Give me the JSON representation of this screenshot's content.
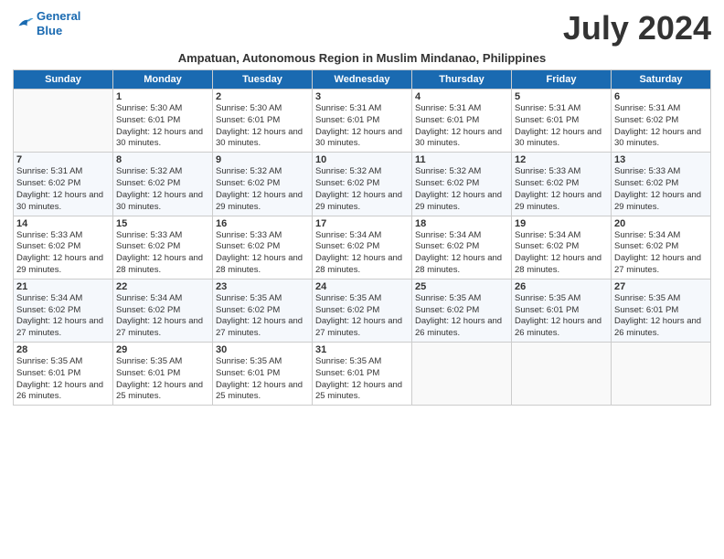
{
  "header": {
    "logo_line1": "General",
    "logo_line2": "Blue",
    "month_year": "July 2024",
    "subtitle": "Ampatuan, Autonomous Region in Muslim Mindanao, Philippines"
  },
  "days_of_week": [
    "Sunday",
    "Monday",
    "Tuesday",
    "Wednesday",
    "Thursday",
    "Friday",
    "Saturday"
  ],
  "weeks": [
    [
      {
        "day": "",
        "sunrise": "",
        "sunset": "",
        "daylight": ""
      },
      {
        "day": "1",
        "sunrise": "Sunrise: 5:30 AM",
        "sunset": "Sunset: 6:01 PM",
        "daylight": "Daylight: 12 hours and 30 minutes."
      },
      {
        "day": "2",
        "sunrise": "Sunrise: 5:30 AM",
        "sunset": "Sunset: 6:01 PM",
        "daylight": "Daylight: 12 hours and 30 minutes."
      },
      {
        "day": "3",
        "sunrise": "Sunrise: 5:31 AM",
        "sunset": "Sunset: 6:01 PM",
        "daylight": "Daylight: 12 hours and 30 minutes."
      },
      {
        "day": "4",
        "sunrise": "Sunrise: 5:31 AM",
        "sunset": "Sunset: 6:01 PM",
        "daylight": "Daylight: 12 hours and 30 minutes."
      },
      {
        "day": "5",
        "sunrise": "Sunrise: 5:31 AM",
        "sunset": "Sunset: 6:01 PM",
        "daylight": "Daylight: 12 hours and 30 minutes."
      },
      {
        "day": "6",
        "sunrise": "Sunrise: 5:31 AM",
        "sunset": "Sunset: 6:02 PM",
        "daylight": "Daylight: 12 hours and 30 minutes."
      }
    ],
    [
      {
        "day": "7",
        "sunrise": "Sunrise: 5:31 AM",
        "sunset": "Sunset: 6:02 PM",
        "daylight": "Daylight: 12 hours and 30 minutes."
      },
      {
        "day": "8",
        "sunrise": "Sunrise: 5:32 AM",
        "sunset": "Sunset: 6:02 PM",
        "daylight": "Daylight: 12 hours and 30 minutes."
      },
      {
        "day": "9",
        "sunrise": "Sunrise: 5:32 AM",
        "sunset": "Sunset: 6:02 PM",
        "daylight": "Daylight: 12 hours and 29 minutes."
      },
      {
        "day": "10",
        "sunrise": "Sunrise: 5:32 AM",
        "sunset": "Sunset: 6:02 PM",
        "daylight": "Daylight: 12 hours and 29 minutes."
      },
      {
        "day": "11",
        "sunrise": "Sunrise: 5:32 AM",
        "sunset": "Sunset: 6:02 PM",
        "daylight": "Daylight: 12 hours and 29 minutes."
      },
      {
        "day": "12",
        "sunrise": "Sunrise: 5:33 AM",
        "sunset": "Sunset: 6:02 PM",
        "daylight": "Daylight: 12 hours and 29 minutes."
      },
      {
        "day": "13",
        "sunrise": "Sunrise: 5:33 AM",
        "sunset": "Sunset: 6:02 PM",
        "daylight": "Daylight: 12 hours and 29 minutes."
      }
    ],
    [
      {
        "day": "14",
        "sunrise": "Sunrise: 5:33 AM",
        "sunset": "Sunset: 6:02 PM",
        "daylight": "Daylight: 12 hours and 29 minutes."
      },
      {
        "day": "15",
        "sunrise": "Sunrise: 5:33 AM",
        "sunset": "Sunset: 6:02 PM",
        "daylight": "Daylight: 12 hours and 28 minutes."
      },
      {
        "day": "16",
        "sunrise": "Sunrise: 5:33 AM",
        "sunset": "Sunset: 6:02 PM",
        "daylight": "Daylight: 12 hours and 28 minutes."
      },
      {
        "day": "17",
        "sunrise": "Sunrise: 5:34 AM",
        "sunset": "Sunset: 6:02 PM",
        "daylight": "Daylight: 12 hours and 28 minutes."
      },
      {
        "day": "18",
        "sunrise": "Sunrise: 5:34 AM",
        "sunset": "Sunset: 6:02 PM",
        "daylight": "Daylight: 12 hours and 28 minutes."
      },
      {
        "day": "19",
        "sunrise": "Sunrise: 5:34 AM",
        "sunset": "Sunset: 6:02 PM",
        "daylight": "Daylight: 12 hours and 28 minutes."
      },
      {
        "day": "20",
        "sunrise": "Sunrise: 5:34 AM",
        "sunset": "Sunset: 6:02 PM",
        "daylight": "Daylight: 12 hours and 27 minutes."
      }
    ],
    [
      {
        "day": "21",
        "sunrise": "Sunrise: 5:34 AM",
        "sunset": "Sunset: 6:02 PM",
        "daylight": "Daylight: 12 hours and 27 minutes."
      },
      {
        "day": "22",
        "sunrise": "Sunrise: 5:34 AM",
        "sunset": "Sunset: 6:02 PM",
        "daylight": "Daylight: 12 hours and 27 minutes."
      },
      {
        "day": "23",
        "sunrise": "Sunrise: 5:35 AM",
        "sunset": "Sunset: 6:02 PM",
        "daylight": "Daylight: 12 hours and 27 minutes."
      },
      {
        "day": "24",
        "sunrise": "Sunrise: 5:35 AM",
        "sunset": "Sunset: 6:02 PM",
        "daylight": "Daylight: 12 hours and 27 minutes."
      },
      {
        "day": "25",
        "sunrise": "Sunrise: 5:35 AM",
        "sunset": "Sunset: 6:02 PM",
        "daylight": "Daylight: 12 hours and 26 minutes."
      },
      {
        "day": "26",
        "sunrise": "Sunrise: 5:35 AM",
        "sunset": "Sunset: 6:01 PM",
        "daylight": "Daylight: 12 hours and 26 minutes."
      },
      {
        "day": "27",
        "sunrise": "Sunrise: 5:35 AM",
        "sunset": "Sunset: 6:01 PM",
        "daylight": "Daylight: 12 hours and 26 minutes."
      }
    ],
    [
      {
        "day": "28",
        "sunrise": "Sunrise: 5:35 AM",
        "sunset": "Sunset: 6:01 PM",
        "daylight": "Daylight: 12 hours and 26 minutes."
      },
      {
        "day": "29",
        "sunrise": "Sunrise: 5:35 AM",
        "sunset": "Sunset: 6:01 PM",
        "daylight": "Daylight: 12 hours and 25 minutes."
      },
      {
        "day": "30",
        "sunrise": "Sunrise: 5:35 AM",
        "sunset": "Sunset: 6:01 PM",
        "daylight": "Daylight: 12 hours and 25 minutes."
      },
      {
        "day": "31",
        "sunrise": "Sunrise: 5:35 AM",
        "sunset": "Sunset: 6:01 PM",
        "daylight": "Daylight: 12 hours and 25 minutes."
      },
      {
        "day": "",
        "sunrise": "",
        "sunset": "",
        "daylight": ""
      },
      {
        "day": "",
        "sunrise": "",
        "sunset": "",
        "daylight": ""
      },
      {
        "day": "",
        "sunrise": "",
        "sunset": "",
        "daylight": ""
      }
    ]
  ]
}
